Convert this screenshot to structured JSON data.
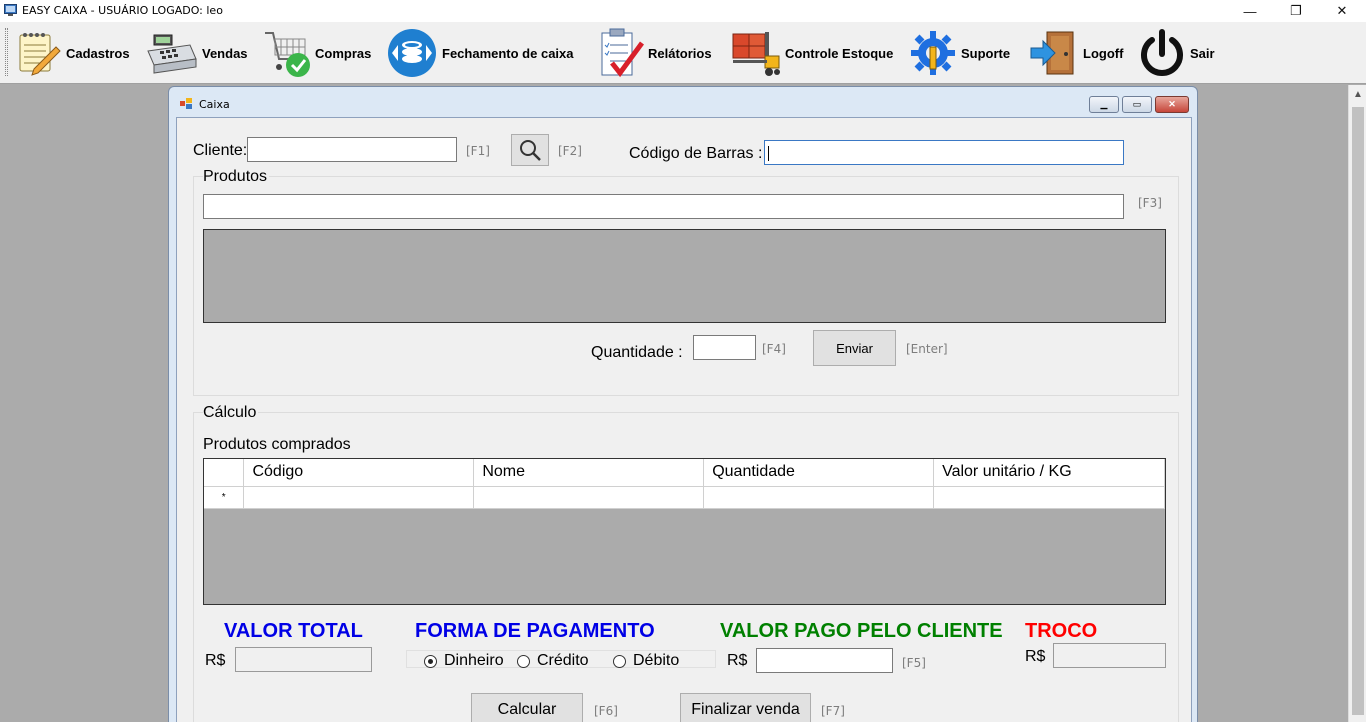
{
  "window": {
    "title": "EASY CAIXA - USUÁRIO LOGADO: leo",
    "minimize": "—",
    "restore": "❐",
    "close": "✕"
  },
  "toolbar": {
    "items": [
      {
        "label": "Cadastros",
        "icon": "notepad-pencil-icon"
      },
      {
        "label": "Vendas",
        "icon": "cash-register-icon"
      },
      {
        "label": "Compras",
        "icon": "shopping-cart-check-icon"
      },
      {
        "label": "Fechamento de caixa",
        "icon": "coins-arrows-icon"
      },
      {
        "label": "Relátorios",
        "icon": "checklist-icon"
      },
      {
        "label": "Controle Estoque",
        "icon": "forklift-boxes-icon"
      },
      {
        "label": "Suporte",
        "icon": "gear-wrench-icon"
      },
      {
        "label": "Logoff",
        "icon": "door-exit-icon"
      },
      {
        "label": "Sair",
        "icon": "power-icon"
      }
    ]
  },
  "caixa": {
    "caption": "Caixa",
    "cliente_label": "Cliente:",
    "cliente_value": "",
    "f1": "[F1]",
    "f2": "[F2]",
    "codigo_barras_label": "Código de Barras :",
    "codigo_barras_value": "",
    "produtos_group": "Produtos",
    "produto_search_value": "",
    "f3": "[F3]",
    "quantidade_label": "Quantidade :",
    "quantidade_value": "",
    "f4": "[F4]",
    "enviar_label": "Enviar",
    "enter_hint": "[Enter]",
    "calculo_group": "Cálculo",
    "comprados_label": "Produtos comprados",
    "columns": [
      "Código",
      "Nome",
      "Quantidade",
      "Valor unitário / KG"
    ],
    "new_row_marker": "*",
    "valor_total_label": "VALOR TOTAL",
    "valor_total_currency": "R$",
    "valor_total_value": "",
    "forma_pagamento_label": "FORMA DE PAGAMENTO",
    "payment_options": [
      {
        "label": "Dinheiro",
        "selected": true
      },
      {
        "label": "Crédito",
        "selected": false
      },
      {
        "label": "Débito",
        "selected": false
      }
    ],
    "valor_pago_label": "VALOR PAGO PELO CLIENTE",
    "valor_pago_currency": "R$",
    "valor_pago_value": "",
    "f5": "[F5]",
    "troco_label": "TROCO",
    "troco_currency": "R$",
    "troco_value": "",
    "calcular_label": "Calcular",
    "f6": "[F6]",
    "finalizar_label": "Finalizar venda",
    "f7": "[F7]"
  },
  "colors": {
    "valor_total": "#0000e6",
    "forma_pagamento": "#0000e6",
    "valor_pago": "#008000",
    "troco": "#ff0000",
    "grid_background": "#ababab"
  }
}
